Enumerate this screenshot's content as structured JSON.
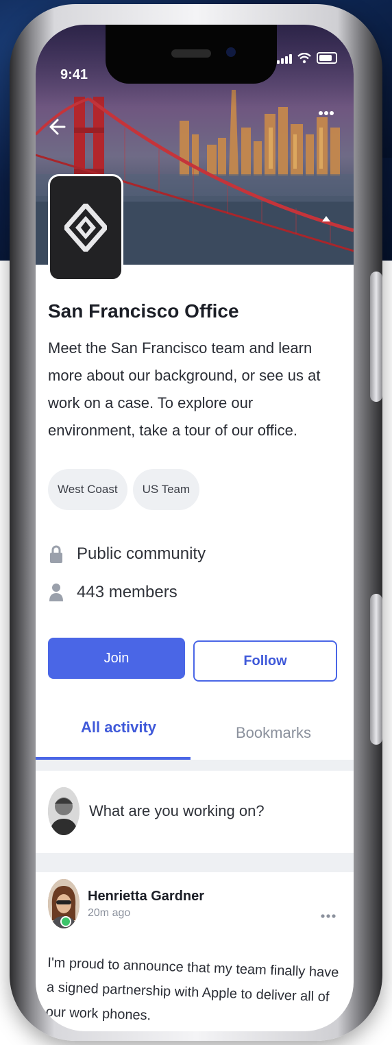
{
  "status_bar": {
    "time": "9:41"
  },
  "community": {
    "title": "San Francisco Office",
    "description": "Meet the San Francisco team and learn more about our background, or see us at work on a case. To explore our environment, take a tour of our office.",
    "tags": [
      "West Coast",
      "US Team"
    ],
    "privacy": "Public community",
    "members": "443 members"
  },
  "actions": {
    "join_label": "Join",
    "follow_label": "Follow"
  },
  "tabs": [
    {
      "label": "All activity",
      "active": true
    },
    {
      "label": "Bookmarks",
      "active": false
    }
  ],
  "composer": {
    "placeholder": "What are you working on?"
  },
  "post": {
    "author": "Henrietta Gardner",
    "time": "20m ago",
    "body": "I'm proud to announce that my team finally have a signed partnership with Apple to deliver all of our work phones."
  },
  "icons": {
    "back": "arrow-left-icon",
    "more": "more-dots-icon",
    "collapse": "caret-up-icon",
    "lock": "lock-icon",
    "members": "person-icon",
    "signal": "cellular-signal-icon",
    "wifi": "wifi-icon",
    "battery": "battery-icon"
  },
  "colors": {
    "accent": "#4a66e6",
    "online": "#3cc46a",
    "chip_bg": "#eef0f3"
  }
}
